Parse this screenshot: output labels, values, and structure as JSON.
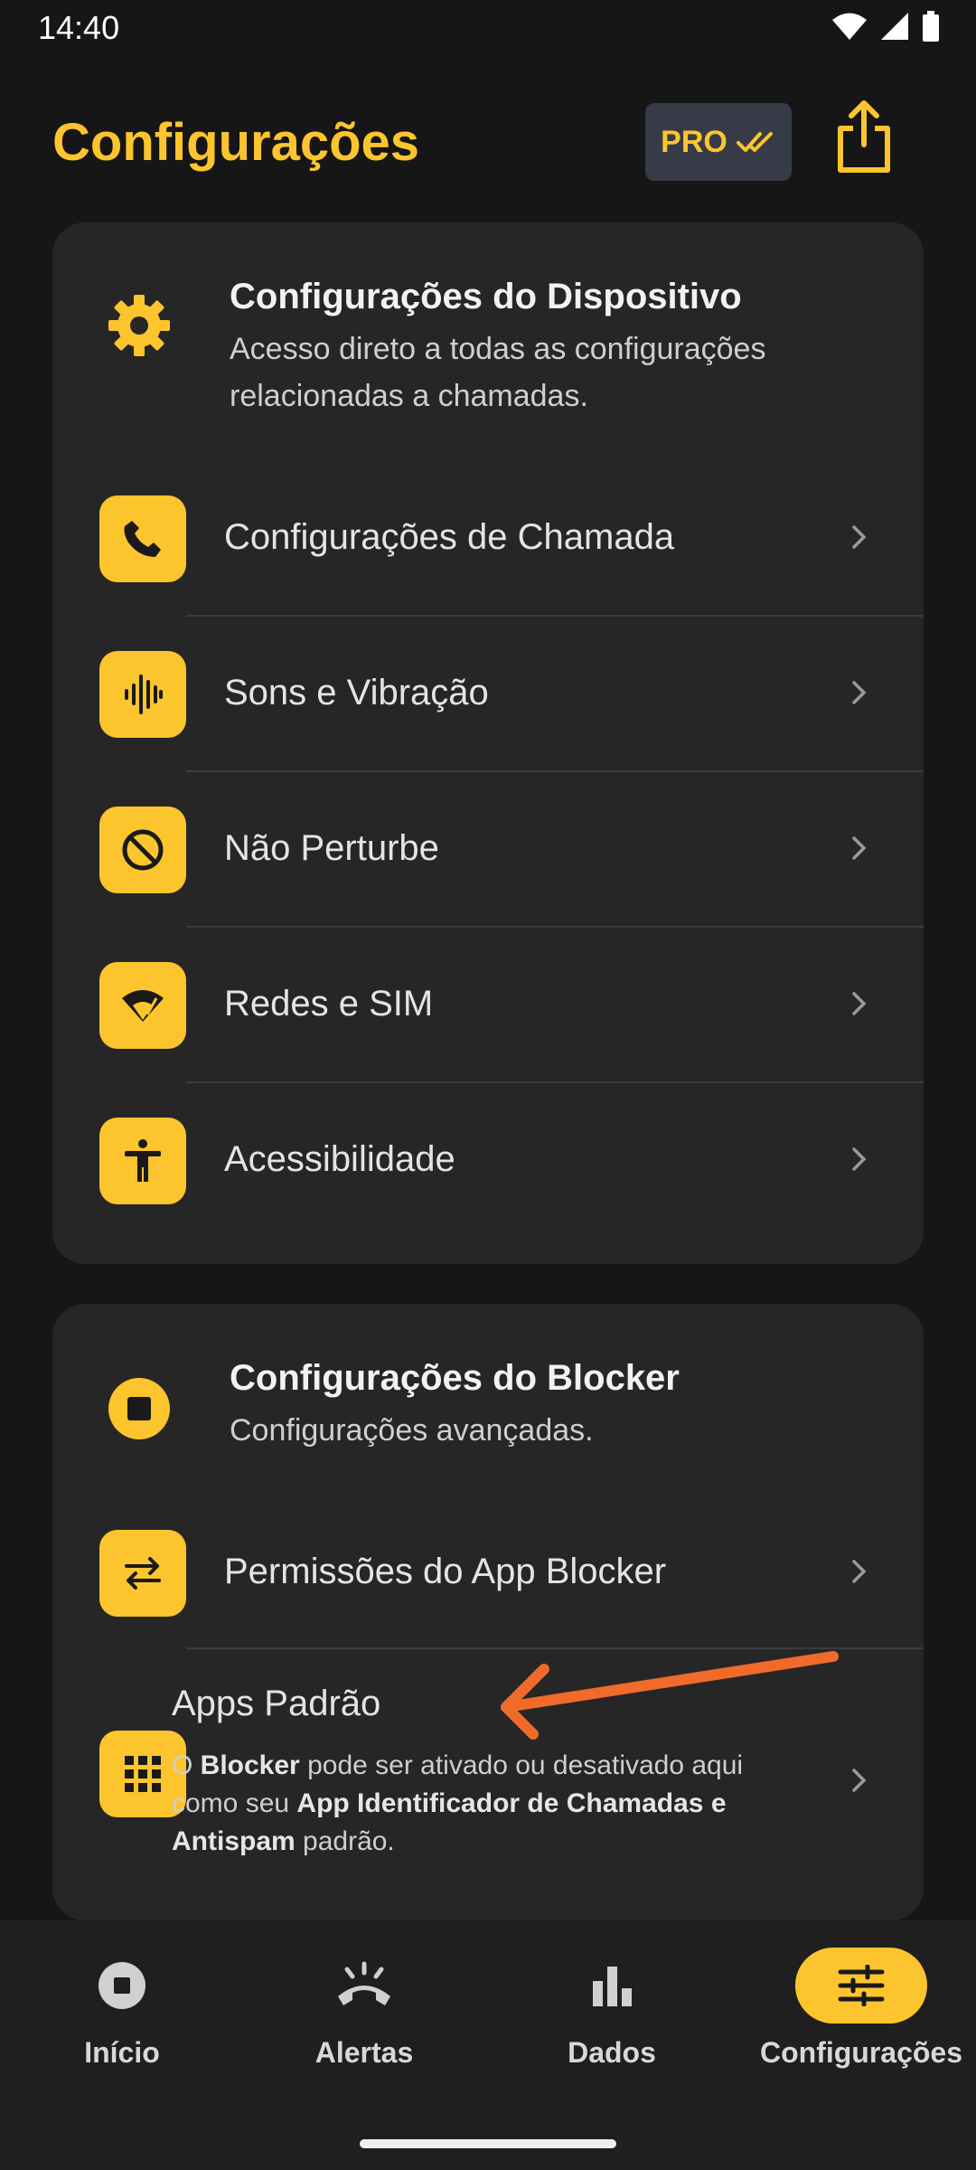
{
  "status_bar": {
    "time": "14:40"
  },
  "header": {
    "title": "Configurações",
    "pro_label": "PRO"
  },
  "device_section": {
    "title": "Configurações do Dispositivo",
    "description": "Acesso direto a todas as configurações relacionadas a chamadas.",
    "items": [
      {
        "label": "Configurações de Chamada",
        "icon": "phone-icon"
      },
      {
        "label": "Sons e Vibração",
        "icon": "sound-wave-icon"
      },
      {
        "label": "Não Perturbe",
        "icon": "do-not-disturb-icon"
      },
      {
        "label": "Redes e SIM",
        "icon": "network-icon"
      },
      {
        "label": "Acessibilidade",
        "icon": "accessibility-icon"
      }
    ]
  },
  "blocker_section": {
    "title": "Configurações do Blocker",
    "description": "Configurações avançadas.",
    "items": [
      {
        "label": "Permissões do App Blocker",
        "icon": "swap-arrows-icon"
      }
    ],
    "apps": {
      "title": "Apps Padrão",
      "desc_1": "O ",
      "desc_bold_1": "Blocker",
      "desc_2": " pode ser ativado ou desativado aqui como seu ",
      "desc_bold_2": "App Identificador de Chamadas e Antispam",
      "desc_3": " padrão."
    }
  },
  "bottom_nav": [
    {
      "label": "Início",
      "icon": "stop-circle-icon",
      "active": false
    },
    {
      "label": "Alertas",
      "icon": "ringing-phone-icon",
      "active": false
    },
    {
      "label": "Dados",
      "icon": "bar-chart-icon",
      "active": false
    },
    {
      "label": "Configurações",
      "icon": "sliders-icon",
      "active": true
    }
  ],
  "colors": {
    "accent": "#fdc52d",
    "background": "#161616",
    "card": "#262626",
    "annotation_arrow": "#f06a2a"
  }
}
